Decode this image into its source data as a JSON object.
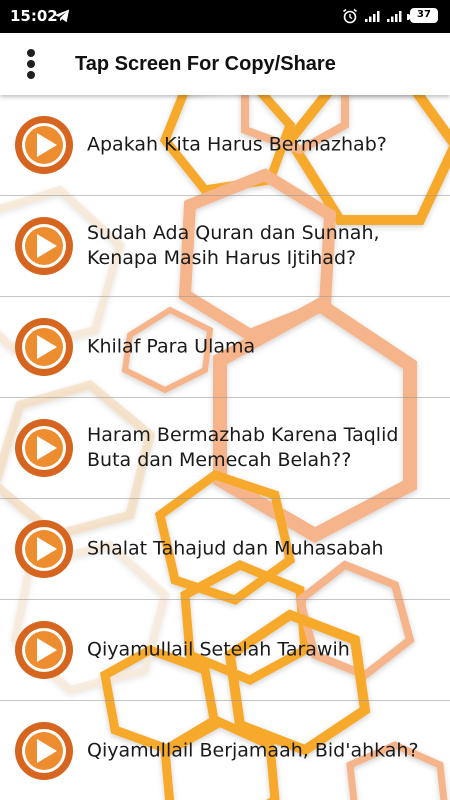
{
  "status_bar": {
    "time": "15:02",
    "battery": "37",
    "icons": [
      "telegram-icon",
      "alarm-icon",
      "signal-icon",
      "signal-icon",
      "battery-icon"
    ]
  },
  "app_bar": {
    "title": "Tap Screen For Copy/Share",
    "menu_icon": "more-vertical-icon"
  },
  "list": {
    "items": [
      {
        "title": "Apakah Kita Harus Bermazhab?"
      },
      {
        "title": "Sudah Ada Quran dan Sunnah, Kenapa Masih Harus Ijtihad?"
      },
      {
        "title": "Khilaf Para Ulama"
      },
      {
        "title": "Haram Bermazhab Karena Taqlid Buta dan Memecah Belah??"
      },
      {
        "title": "Shalat Tahajud dan Muhasabah"
      },
      {
        "title": "Qiyamullail Setelah Tarawih"
      },
      {
        "title": "Qiyamullail Berjamaah, Bid'ahkah?"
      }
    ]
  },
  "colors": {
    "play_outer": "#d6651f",
    "play_inner": "#ee8d2f",
    "hex_orange": "#f6a92a",
    "hex_peach": "#f5b48a"
  }
}
